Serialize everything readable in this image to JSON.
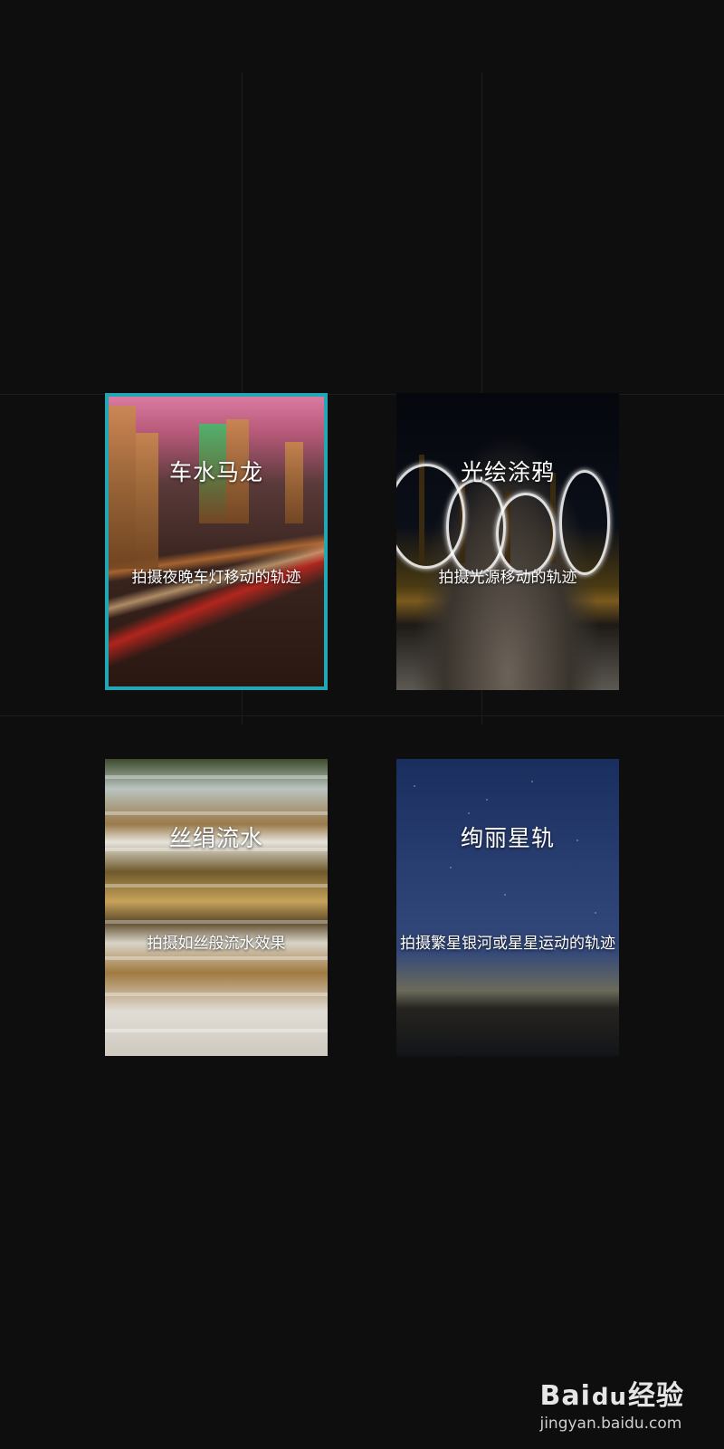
{
  "modes": [
    {
      "title": "车水马龙",
      "description": "拍摄夜晚车灯移动的轨迹",
      "selected": true
    },
    {
      "title": "光绘涂鸦",
      "description": "拍摄光源移动的轨迹",
      "selected": false
    },
    {
      "title": "丝绢流水",
      "description": "拍摄如丝般流水效果",
      "selected": false
    },
    {
      "title": "绚丽星轨",
      "description": "拍摄繁星银河或星星运动的轨迹",
      "selected": false
    }
  ],
  "watermark": {
    "brand": "Bai",
    "brand_suffix": "经验",
    "paw": "du",
    "url": "jingyan.baidu.com"
  },
  "colors": {
    "selected_border": "#22a8b4",
    "background": "#0e0e0e"
  }
}
